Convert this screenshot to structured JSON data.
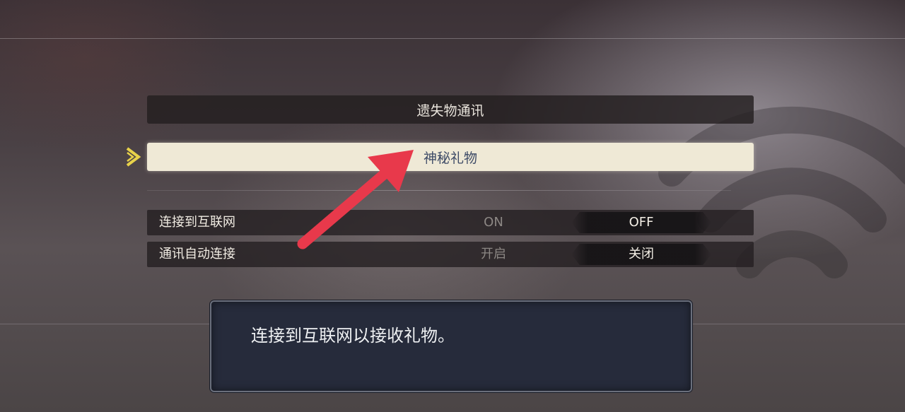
{
  "menu": {
    "lost_items": "遗失物通讯",
    "mystery_gift": "神秘礼物"
  },
  "options": [
    {
      "label": "连接到互联网",
      "on": "ON",
      "off": "OFF"
    },
    {
      "label": "通讯自动连接",
      "on": "开启",
      "off": "关闭"
    }
  ],
  "help": {
    "text": "连接到互联网以接收礼物。"
  },
  "colors": {
    "selected_bg": "#efe9d6",
    "selected_text": "#3d4a66",
    "cursor": "#e8d24a",
    "annotation_arrow": "#e8394b",
    "help_bg": "#262b3b"
  },
  "icons": {
    "cursor": "chevron-right-icon",
    "background": "wifi-icon",
    "annotation": "red-arrow-icon"
  }
}
